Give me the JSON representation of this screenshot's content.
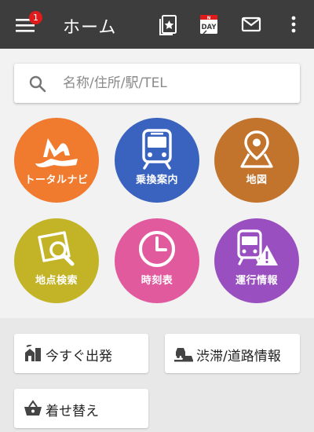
{
  "header": {
    "title": "ホーム",
    "notification_count": "1",
    "nday_line1": "N",
    "nday_line2": "DAY"
  },
  "search": {
    "placeholder": "名称/住所/駅/TEL"
  },
  "tiles": [
    {
      "label": "トータルナビ",
      "color": "#f07a2e",
      "icon": "total-navi-icon"
    },
    {
      "label": "乗換案内",
      "color": "#3a63c0",
      "icon": "train-icon"
    },
    {
      "label": "地図",
      "color": "#c2732c",
      "icon": "map-pin-icon"
    },
    {
      "label": "地点検索",
      "color": "#c2b426",
      "icon": "map-search-icon"
    },
    {
      "label": "時刻表",
      "color": "#e15a9e",
      "icon": "clock-icon"
    },
    {
      "label": "運行情報",
      "color": "#9a4fc0",
      "icon": "train-warning-icon"
    }
  ],
  "quick_actions": [
    {
      "label": "今すぐ出発",
      "icon": "depart-now-icon"
    },
    {
      "label": "渋滞/道路情報",
      "icon": "traffic-icon"
    },
    {
      "label": "着せ替え",
      "icon": "basket-icon"
    }
  ],
  "colors": {
    "topbar": "#3d3d3d",
    "badge": "#e01b1b",
    "background": "#f2f2f2",
    "lower_background": "#e8e8e8"
  }
}
